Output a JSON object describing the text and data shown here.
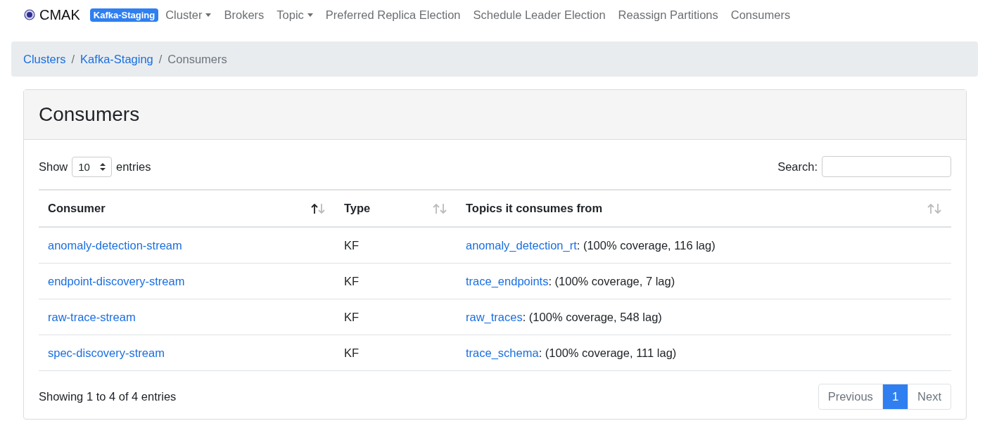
{
  "navbar": {
    "brand": "CMAK",
    "cluster_badge": "Kafka-Staging",
    "items": [
      {
        "label": "Cluster",
        "dropdown": true
      },
      {
        "label": "Brokers",
        "dropdown": false
      },
      {
        "label": "Topic",
        "dropdown": true
      },
      {
        "label": "Preferred Replica Election",
        "dropdown": false
      },
      {
        "label": "Schedule Leader Election",
        "dropdown": false
      },
      {
        "label": "Reassign Partitions",
        "dropdown": false
      },
      {
        "label": "Consumers",
        "dropdown": false
      }
    ]
  },
  "breadcrumb": {
    "separator": "/",
    "items": [
      {
        "label": "Clusters",
        "link": true
      },
      {
        "label": "Kafka-Staging",
        "link": true
      },
      {
        "label": "Consumers",
        "link": false
      }
    ]
  },
  "card": {
    "title": "Consumers",
    "length_menu": {
      "before": "Show",
      "value": "10",
      "after": "entries"
    },
    "search": {
      "label": "Search:"
    },
    "table": {
      "columns": [
        {
          "label": "Consumer",
          "sorted": true
        },
        {
          "label": "Type",
          "sorted": false
        },
        {
          "label": "Topics it consumes from",
          "sorted": false
        }
      ],
      "rows": [
        {
          "consumer": "anomaly-detection-stream",
          "type": "KF",
          "topic": "anomaly_detection_rt",
          "detail": ": (100% coverage, 116 lag)"
        },
        {
          "consumer": "endpoint-discovery-stream",
          "type": "KF",
          "topic": "trace_endpoints",
          "detail": ": (100% coverage, 7 lag)"
        },
        {
          "consumer": "raw-trace-stream",
          "type": "KF",
          "topic": "raw_traces",
          "detail": ": (100% coverage, 548 lag)"
        },
        {
          "consumer": "spec-discovery-stream",
          "type": "KF",
          "topic": "trace_schema",
          "detail": ": (100% coverage, 111 lag)"
        }
      ]
    },
    "info": "Showing 1 to 4 of 4 entries",
    "pagination": [
      {
        "label": "Previous",
        "selected": false
      },
      {
        "label": "1",
        "selected": true
      },
      {
        "label": "Next",
        "selected": false
      }
    ]
  }
}
